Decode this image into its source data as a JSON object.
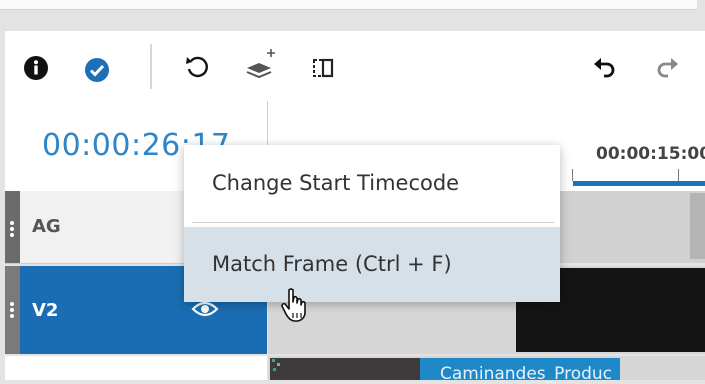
{
  "toolbar": {
    "icons": [
      "info-icon",
      "check-icon",
      "undo-history-icon",
      "add-layer-icon",
      "split-icon",
      "undo-icon",
      "redo-icon"
    ]
  },
  "timeline": {
    "timecode": "00:00:26:17",
    "ruler_label": "00:00:15:00"
  },
  "tracks": [
    {
      "name": "AG",
      "selected": false
    },
    {
      "name": "V2",
      "selected": true,
      "icon": "eye-icon"
    }
  ],
  "clips": {
    "v1_clip_label": "Caminandes_Produc"
  },
  "context_menu": {
    "items": [
      {
        "label": "Change Start Timecode",
        "highlighted": false
      },
      {
        "label": "Match Frame (Ctrl + F)",
        "highlighted": true
      }
    ]
  },
  "colors": {
    "accent": "#1a6db2",
    "timecode": "#2e86c8",
    "menu_highlight": "#d6e0e8"
  }
}
